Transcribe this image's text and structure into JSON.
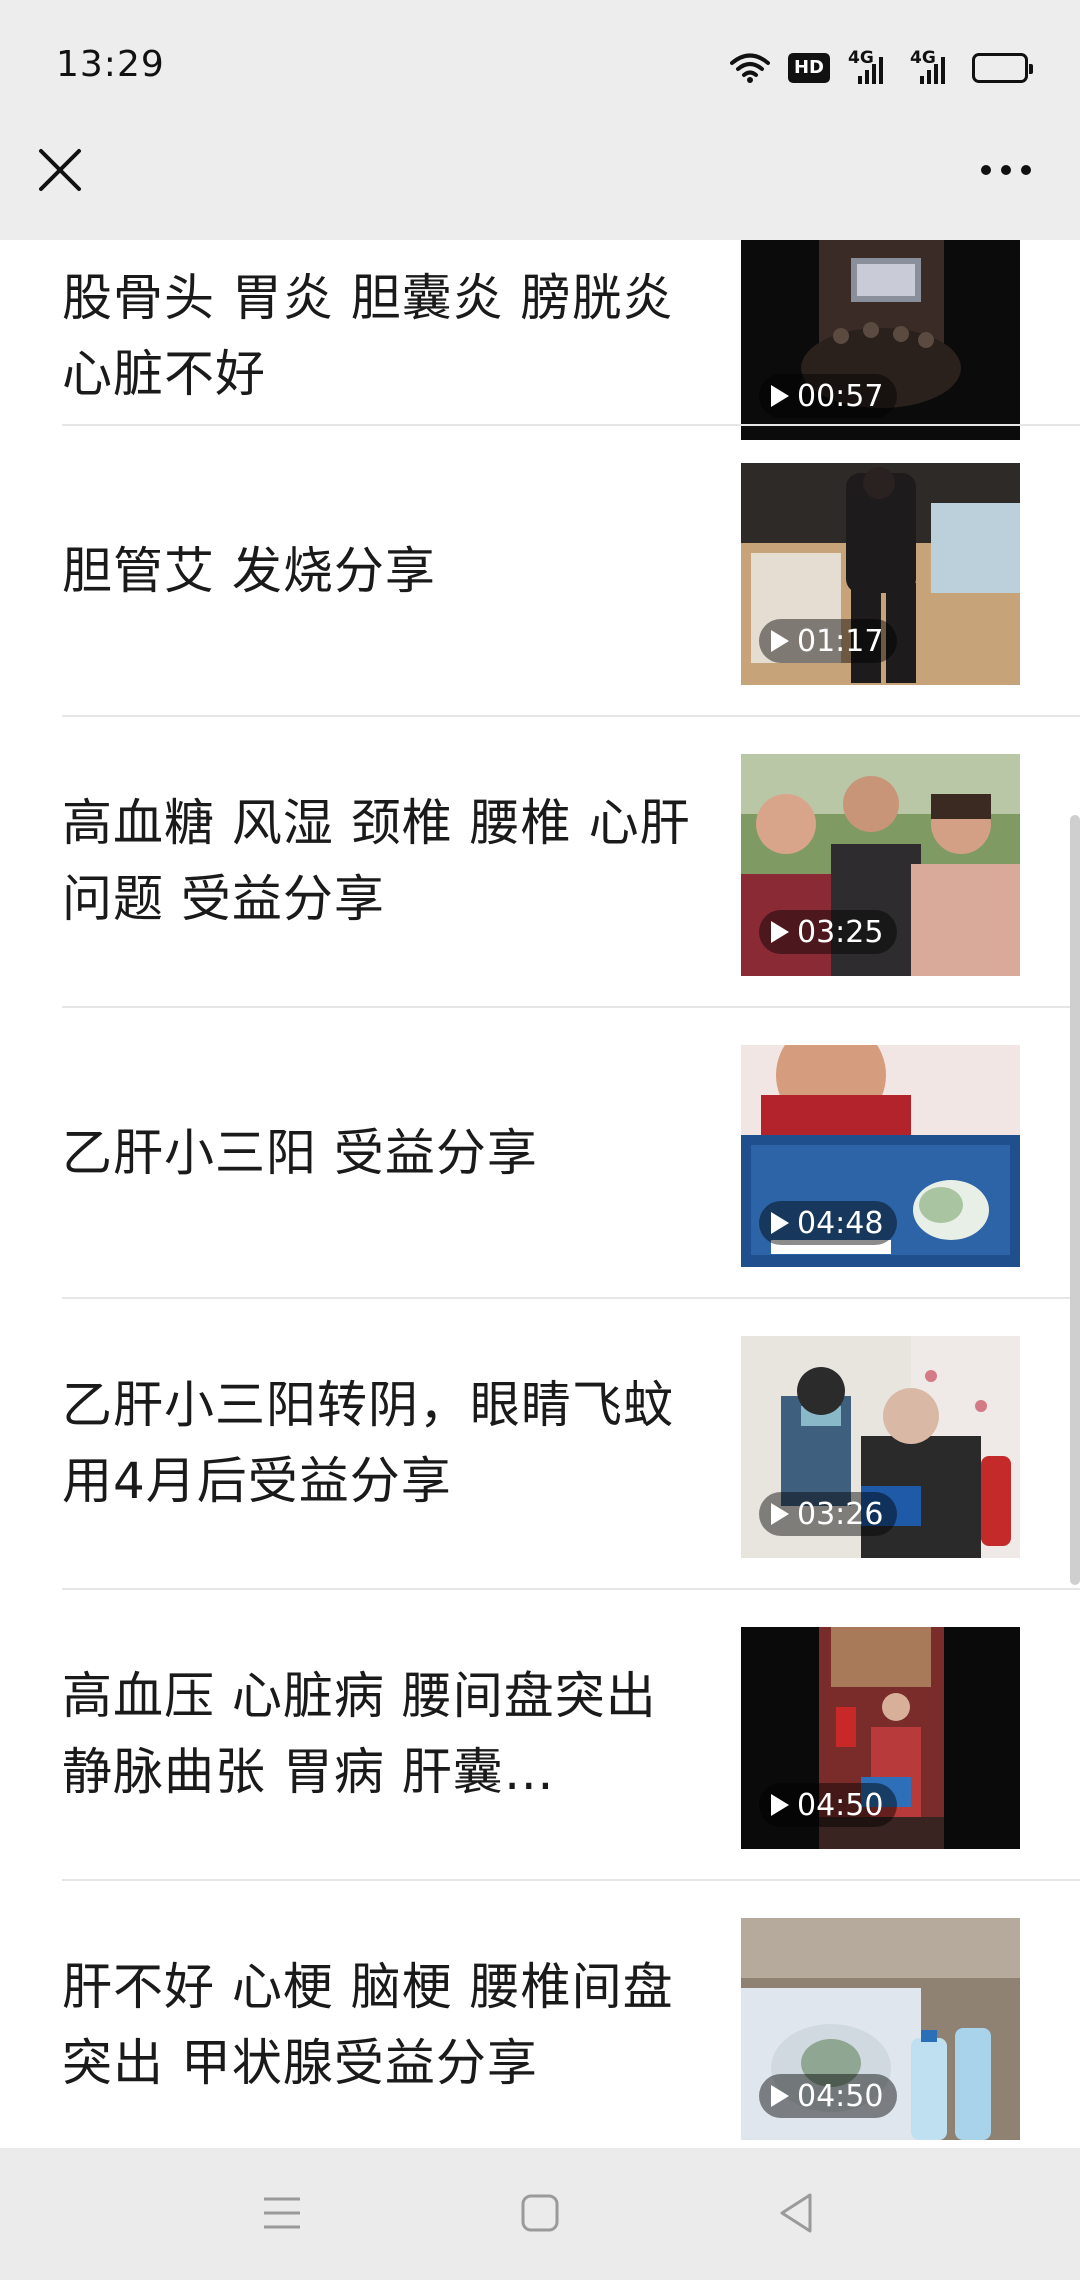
{
  "status": {
    "time": "13:29",
    "hd_label": "HD",
    "net1": "4G",
    "net2": "4G"
  },
  "colors": {
    "battery": "#f2c318",
    "topbar_bg": "#ededed",
    "navbar_bg": "#ebebeb"
  },
  "articles": [
    {
      "title": "股骨头 胃炎 胆囊炎 膀胱炎 心脏不好",
      "duration": "00:57"
    },
    {
      "title": "胆管艾 发烧分享",
      "duration": "01:17"
    },
    {
      "title": "高血糖 风湿 颈椎 腰椎 心肝问题 受益分享",
      "duration": "03:25"
    },
    {
      "title": "乙肝小三阳 受益分享",
      "duration": "04:48"
    },
    {
      "title": "乙肝小三阳转阴，眼睛飞蚊 用4月后受益分享",
      "duration": "03:26"
    },
    {
      "title": "高血压 心脏病 腰间盘突出 静脉曲张 胃病 肝囊…",
      "duration": "04:50"
    },
    {
      "title": "肝不好 心梗 脑梗 腰椎间盘突出 甲状腺受益分享",
      "duration": "04:50"
    }
  ],
  "nav": {
    "icons": [
      "menu-icon",
      "home-square-icon",
      "back-triangle-icon"
    ]
  }
}
